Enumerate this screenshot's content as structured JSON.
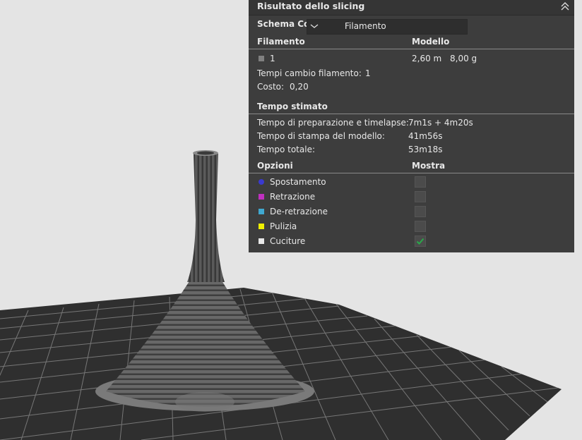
{
  "panel": {
    "title": "Risultato dello slicing",
    "color_scheme": {
      "label": "Schema Colore",
      "value": "Filamento"
    },
    "filament": {
      "header_filament": "Filamento",
      "header_model": "Modello",
      "row": {
        "id": "1",
        "length": "2,60 m",
        "weight": "8,00 g",
        "color": "#808080"
      },
      "changes_label": "Tempi cambio filamento:",
      "changes_value": "1",
      "cost_label": "Costo:",
      "cost_value": "0,20"
    },
    "time": {
      "header": "Tempo stimato",
      "prep_label": "Tempo di preparazione e timelapse:",
      "prep_value": "7m1s + 4m20s",
      "print_label": "Tempo di stampa del modello:",
      "print_value": "41m56s",
      "total_label": "Tempo totale:",
      "total_value": "53m18s"
    },
    "options": {
      "header_options": "Opzioni",
      "header_show": "Mostra",
      "items": [
        {
          "label": "Spostamento",
          "color": "#3a3ad0",
          "checked": false
        },
        {
          "label": "Retrazione",
          "color": "#c030c0",
          "checked": false
        },
        {
          "label": "De-retrazione",
          "color": "#40a8d0",
          "checked": false
        },
        {
          "label": "Pulizia",
          "color": "#f0f000",
          "checked": false
        },
        {
          "label": "Cuciture",
          "color": "#e8e8e8",
          "checked": true
        }
      ]
    }
  },
  "colors": {
    "background": "#e4e4e4",
    "panel": "#3d3d3d",
    "check": "#2aa84a"
  }
}
